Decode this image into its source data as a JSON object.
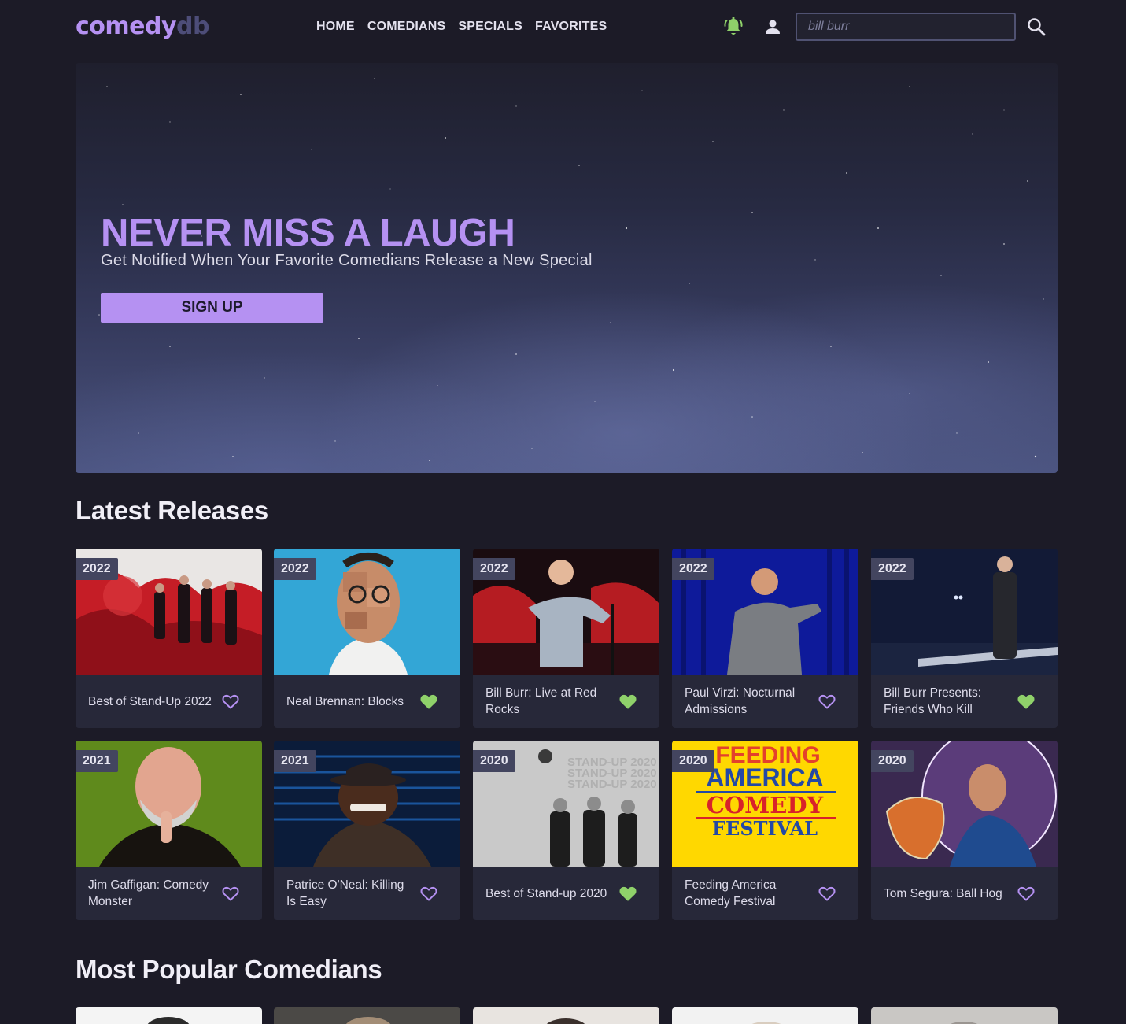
{
  "header": {
    "logo_primary": "comedy",
    "logo_secondary": "db",
    "nav": [
      "HOME",
      "COMEDIANS",
      "SPECIALS",
      "FAVORITES"
    ],
    "search_placeholder": "bill burr",
    "icons": {
      "notifications": "bell-icon",
      "account": "user-icon",
      "search": "search-icon"
    }
  },
  "hero": {
    "title": "NEVER MISS A LAUGH",
    "subtitle": "Get Notified When Your Favorite Comedians Release a New Special",
    "button": "SIGN UP"
  },
  "latest_releases": {
    "heading": "Latest Releases",
    "items": [
      {
        "year": "2022",
        "title": "Best of Stand-Up 2022",
        "favorite": false
      },
      {
        "year": "2022",
        "title": "Neal Brennan: Blocks",
        "favorite": true
      },
      {
        "year": "2022",
        "title": "Bill Burr: Live at Red Rocks",
        "favorite": true
      },
      {
        "year": "2022",
        "title": "Paul Virzi: Nocturnal Admissions",
        "favorite": false
      },
      {
        "year": "2022",
        "title": "Bill Burr Presents: Friends Who Kill",
        "favorite": true
      },
      {
        "year": "2021",
        "title": "Jim Gaffigan: Comedy Monster",
        "favorite": false
      },
      {
        "year": "2021",
        "title": "Patrice O'Neal: Killing Is Easy",
        "favorite": false
      },
      {
        "year": "2020",
        "title": "Best of Stand-up 2020",
        "favorite": true
      },
      {
        "year": "2020",
        "title": "Feeding America Comedy Festival",
        "favorite": false
      },
      {
        "year": "2020",
        "title": "Tom Segura: Ball Hog",
        "favorite": false
      }
    ],
    "poster_text": {
      "feeding_america": [
        "FEEDING",
        "AMERICA",
        "COMEDY",
        "FESTIVAL"
      ],
      "best_of_2020": [
        "STAND-UP 2020",
        "STAND-UP 2020",
        "STAND-UP 2020"
      ]
    }
  },
  "popular": {
    "heading": "Most Popular Comedians"
  },
  "colors": {
    "accent": "#b591f2",
    "favorite_active": "#8fd16a",
    "background": "#1c1b27",
    "card": "#272839"
  }
}
